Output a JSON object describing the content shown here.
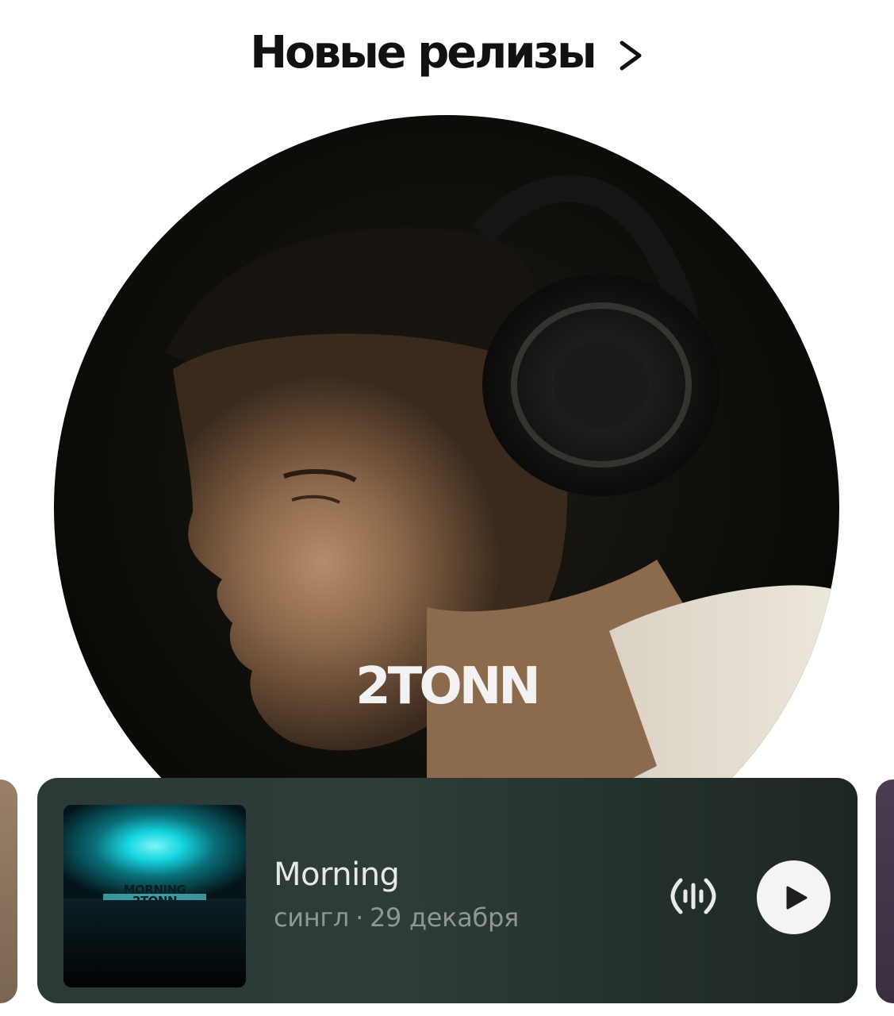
{
  "section": {
    "title": "Новые релизы"
  },
  "artist": {
    "name": "2TONN"
  },
  "release": {
    "cover": {
      "line1": "MORNING",
      "line2": "2TONN"
    },
    "title": "Morning",
    "type": "сингл",
    "separator": "·",
    "date": "29 декабря"
  },
  "icons": {
    "header_chevron": "chevron-right-icon",
    "vibe": "soundwave-icon",
    "play": "play-icon"
  },
  "colors": {
    "card_bg": "#2d3c39",
    "play_button": "#f4f4f4",
    "title_text": "#111111",
    "cover_glow": "#16d6e0"
  }
}
